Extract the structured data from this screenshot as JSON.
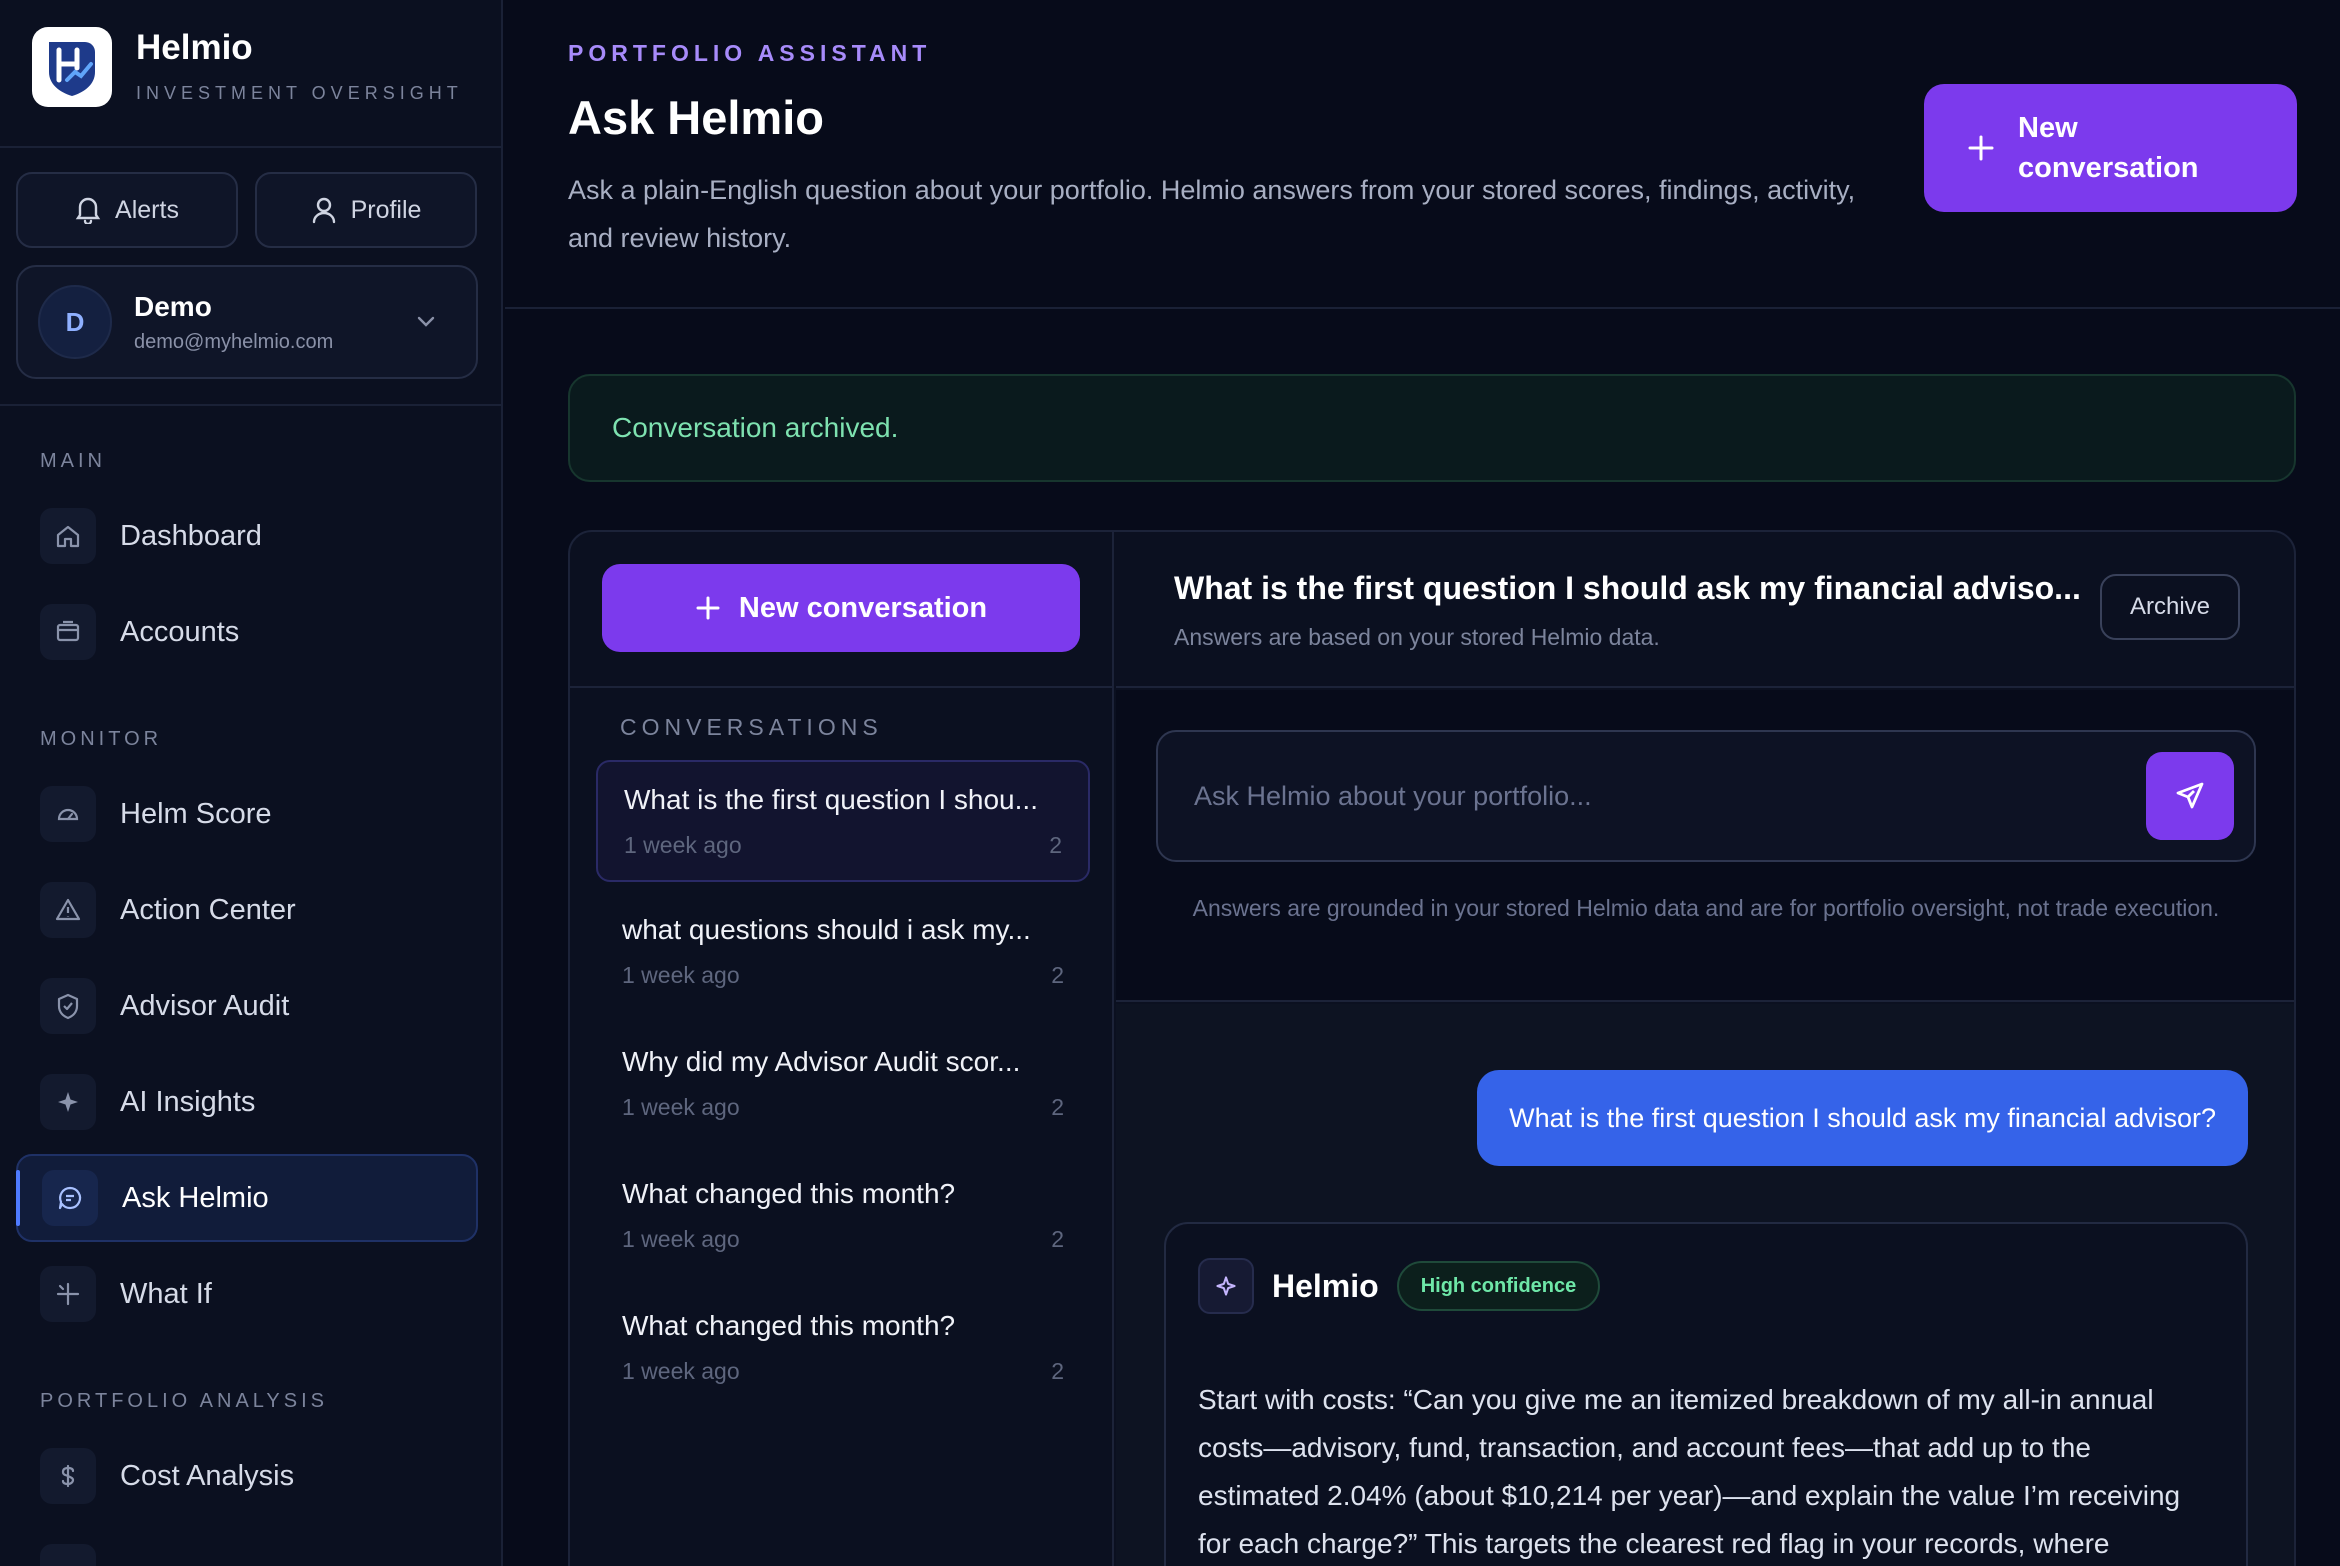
{
  "brand": {
    "name": "Helmio",
    "subtitle": "INVESTMENT OVERSIGHT"
  },
  "top_buttons": {
    "alerts": "Alerts",
    "profile": "Profile"
  },
  "user": {
    "initial": "D",
    "name": "Demo",
    "email": "demo@myhelmio.com"
  },
  "sidebar": {
    "sections": [
      {
        "label": "MAIN",
        "items": [
          {
            "label": "Dashboard",
            "icon": "home-icon"
          },
          {
            "label": "Accounts",
            "icon": "wallet-icon"
          }
        ]
      },
      {
        "label": "MONITOR",
        "items": [
          {
            "label": "Helm Score",
            "icon": "gauge-icon"
          },
          {
            "label": "Action Center",
            "icon": "alert-triangle-icon"
          },
          {
            "label": "Advisor Audit",
            "icon": "shield-icon"
          },
          {
            "label": "AI Insights",
            "icon": "sparkle-icon"
          },
          {
            "label": "Ask Helmio",
            "icon": "chat-icon",
            "active": true
          },
          {
            "label": "What If",
            "icon": "split-icon"
          }
        ]
      },
      {
        "label": "PORTFOLIO ANALYSIS",
        "items": [
          {
            "label": "Cost Analysis",
            "icon": "dollar-icon"
          }
        ]
      }
    ]
  },
  "header": {
    "eyebrow": "PORTFOLIO ASSISTANT",
    "title": "Ask Helmio",
    "description": "Ask a plain-English question about your portfolio. Helmio answers from your stored scores, findings, activity, and review history.",
    "new_button": "New conversation"
  },
  "banner": {
    "text": "Conversation archived."
  },
  "conversations": {
    "new_button": "New conversation",
    "label": "CONVERSATIONS",
    "items": [
      {
        "title": "What is the first question I shou...",
        "time": "1 week ago",
        "count": "2",
        "active": true
      },
      {
        "title": "what questions should i ask my...",
        "time": "1 week ago",
        "count": "2"
      },
      {
        "title": "Why did my Advisor Audit scor...",
        "time": "1 week ago",
        "count": "2"
      },
      {
        "title": "What changed this month?",
        "time": "1 week ago",
        "count": "2"
      },
      {
        "title": "What changed this month?",
        "time": "1 week ago",
        "count": "2"
      }
    ]
  },
  "chat": {
    "title": "What is the first question I should ask my financial adviso...",
    "subtitle": "Answers are based on your stored Helmio data.",
    "archive": "Archive",
    "composer_placeholder": "Ask Helmio about your portfolio...",
    "disclaimer": "Answers are grounded in your stored Helmio data and are for portfolio oversight, not trade execution.",
    "user_message": "What is the first question I should ask my financial advisor?",
    "assistant": {
      "name": "Helmio",
      "confidence": "High confidence",
      "body": "Start with costs: “Can you give me an itemized breakdown of my all-in annual costs—advisory, fund, transaction, and account fees—that add up to the estimated 2.04% (about $10,214 per year)—and explain the value I’m receiving for each charge?” This targets the clearest red flag in your records, where"
    }
  },
  "colors": {
    "accent": "#7c3aed",
    "user_bubble": "#3563e9",
    "success": "#7ee2b0",
    "background": "#070b1a"
  }
}
